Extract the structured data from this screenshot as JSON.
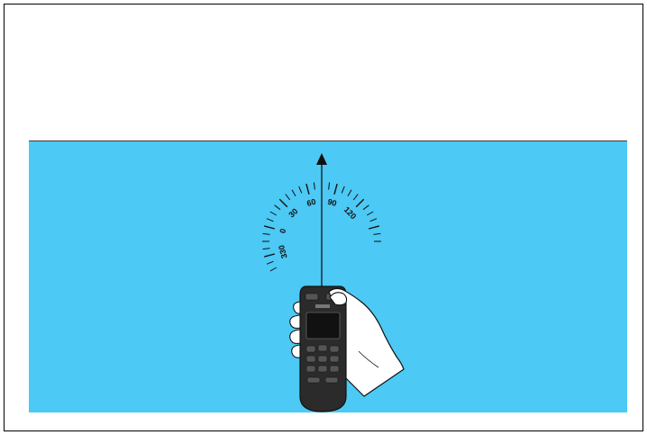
{
  "colors": {
    "water": "#4cc9f4",
    "device_body": "#2b2b2b",
    "device_screen": "#111111",
    "hand_fill": "#ffffff",
    "line": "#111111"
  },
  "compass": {
    "scale_labels": [
      "330",
      "0",
      "30",
      "60",
      "90",
      "120"
    ],
    "label_angles_deg": [
      -60,
      -30,
      0,
      30,
      60,
      90
    ],
    "heading_deg": 45
  },
  "icons": {
    "heading_arrow": "arrow-up-icon",
    "device": "handheld-remote-icon",
    "hand": "hand-icon"
  }
}
